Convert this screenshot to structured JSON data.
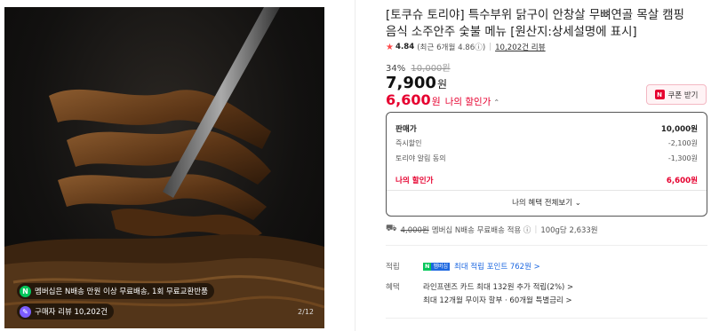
{
  "gallery": {
    "badge_membership": "멤버십은 N배송 만원 이상 무료배송, 1회 무료교환반품",
    "badge_reviews": "구매자 리뷰 10,202건",
    "counter": "2/12"
  },
  "product": {
    "title": "[토쿠슈 토리야] 특수부위 닭구이 안창살 무뼈연골 목살 캠핑음식 소주안주 숯불 메뉴 [원산지:상세설명에 표시]",
    "rating_score": "4.84",
    "rating_recent": "(최근 6개월 4.86",
    "rating_info": "ⓘ)",
    "review_count": "10,202건 리뷰",
    "discount_rate": "34%",
    "original_price": "10,000원",
    "price": "7,900",
    "price_unit": "원",
    "my_price": "6,600",
    "my_price_unit": "원",
    "my_price_label": "나의 할인가",
    "coupon_label": "쿠폰 받기"
  },
  "breakdown": {
    "rows": [
      {
        "label": "판매가",
        "value": "10,000원"
      },
      {
        "label": "즉시할인",
        "value": "-2,100원"
      },
      {
        "label": "토리야 알림 동의",
        "value": "-1,300원"
      },
      {
        "label": "나의 할인가",
        "value": "6,600원"
      }
    ],
    "view_all": "나의 혜택 전체보기 ⌄"
  },
  "shipping": {
    "old_fee": "4,000원",
    "text": "멤버십 N배송 무료배송 적용 ⓘ",
    "unit_price": "100g당 2,633원"
  },
  "benefits": {
    "points_key": "적립",
    "points_badge_n": "N",
    "points_badge_p": "멤버십",
    "points_text": "최대 적립 포인트 762원 >",
    "benefit_key": "혜택",
    "card_text": "라인프렌즈 카드 최대 132원 추가 적립(2%) >",
    "installment_text": "최대 12개월 무이자 할부 · 60개월 특별금리 >"
  },
  "colors": {
    "accent_red": "#e6002f",
    "naver_green": "#03c75a",
    "link_blue": "#1e68e0"
  }
}
